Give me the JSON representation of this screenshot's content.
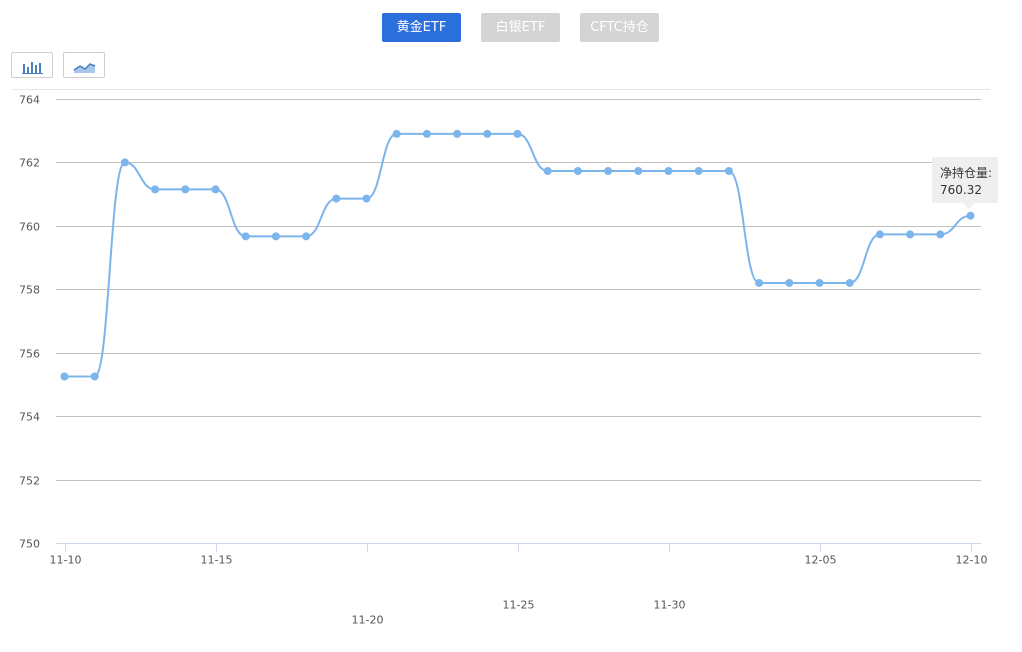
{
  "tabs": [
    {
      "label": "黄金ETF",
      "active": true
    },
    {
      "label": "白银ETF",
      "active": false
    },
    {
      "label": "CFTC持仓",
      "active": false
    }
  ],
  "toolbar": {
    "bar_icon": "bar-chart-icon",
    "line_icon": "line-chart-icon"
  },
  "tooltip": {
    "label": "净持仓量:",
    "value": "760.32"
  },
  "colors": {
    "accent": "#2a6fdb",
    "inactive_tab": "#d4d4d4",
    "line": "#7cb5ec",
    "grid": "#c0c0c0"
  },
  "chart_data": {
    "type": "line",
    "title": "",
    "xlabel": "",
    "ylabel": "",
    "ylim": [
      750,
      764
    ],
    "yticks": [
      750,
      752,
      754,
      756,
      758,
      760,
      762,
      764
    ],
    "grid": true,
    "x": [
      "11-10",
      "11-11",
      "11-12",
      "11-13",
      "11-14",
      "11-15",
      "11-16",
      "11-17",
      "11-18",
      "11-19",
      "11-20",
      "11-21",
      "11-22",
      "11-23",
      "11-24",
      "11-25",
      "11-26",
      "11-27",
      "11-28",
      "11-29",
      "11-30",
      "12-01",
      "12-02",
      "12-03",
      "12-04",
      "12-05",
      "12-06",
      "12-07",
      "12-08",
      "12-09",
      "12-10"
    ],
    "xtick_labels": [
      {
        "label": "11-10",
        "index": 0,
        "row": 0
      },
      {
        "label": "11-15",
        "index": 5,
        "row": 0
      },
      {
        "label": "11-20",
        "index": 10,
        "row": 2
      },
      {
        "label": "11-25",
        "index": 15,
        "row": 1
      },
      {
        "label": "11-30",
        "index": 20,
        "row": 1
      },
      {
        "label": "12-05",
        "index": 25,
        "row": 0
      },
      {
        "label": "12-10",
        "index": 30,
        "row": 0
      }
    ],
    "series": [
      {
        "values": [
          755.25,
          755.25,
          762.0,
          761.15,
          761.15,
          761.15,
          759.67,
          759.67,
          759.67,
          760.86,
          760.86,
          762.9,
          762.9,
          762.9,
          762.9,
          762.9,
          761.73,
          761.73,
          761.73,
          761.73,
          761.73,
          761.73,
          761.73,
          758.2,
          758.2,
          758.2,
          758.2,
          759.73,
          759.73,
          759.73,
          760.32
        ]
      }
    ]
  }
}
